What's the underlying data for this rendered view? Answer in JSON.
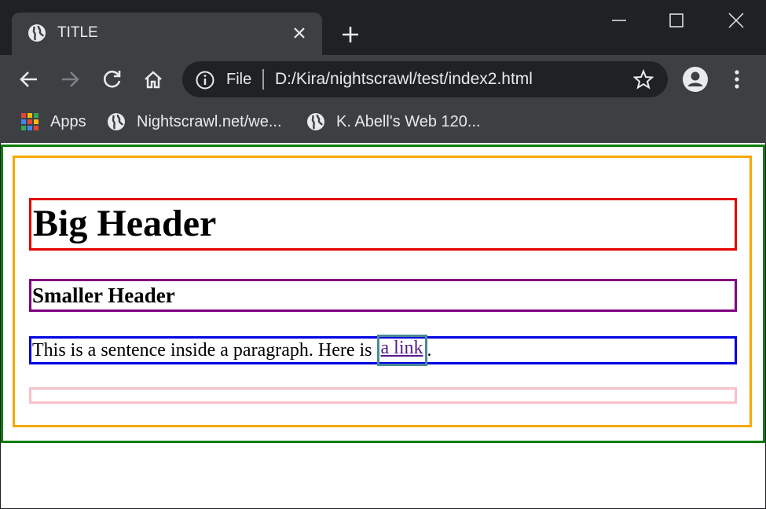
{
  "browser": {
    "tab": {
      "title": "TITLE",
      "favicon": "globe-icon"
    },
    "omnibox": {
      "scheme_label": "File",
      "url": "D:/Kira/nightscrawl/test/index2.html"
    },
    "bookmarks": [
      {
        "label": "Apps",
        "icon": "apps-grid-icon"
      },
      {
        "label": "Nightscrawl.net/we...",
        "icon": "globe-icon"
      },
      {
        "label": "K. Abell's Web 120...",
        "icon": "globe-icon"
      }
    ]
  },
  "page": {
    "big_header": "Big Header",
    "smaller_header": "Smaller Header",
    "paragraph_text": "This is a sentence inside a paragraph. Here is ",
    "link_text": "a link",
    "paragraph_end": "."
  },
  "colors": {
    "green_box": "#0a7d0a",
    "orange_box": "#f5a800",
    "red_box": "#e60000",
    "purple_box": "#800080",
    "blue_box": "#0000e0",
    "teal_box": "#4a8a96",
    "pink_box": "#f6c1c9",
    "link": "#551a8b"
  }
}
